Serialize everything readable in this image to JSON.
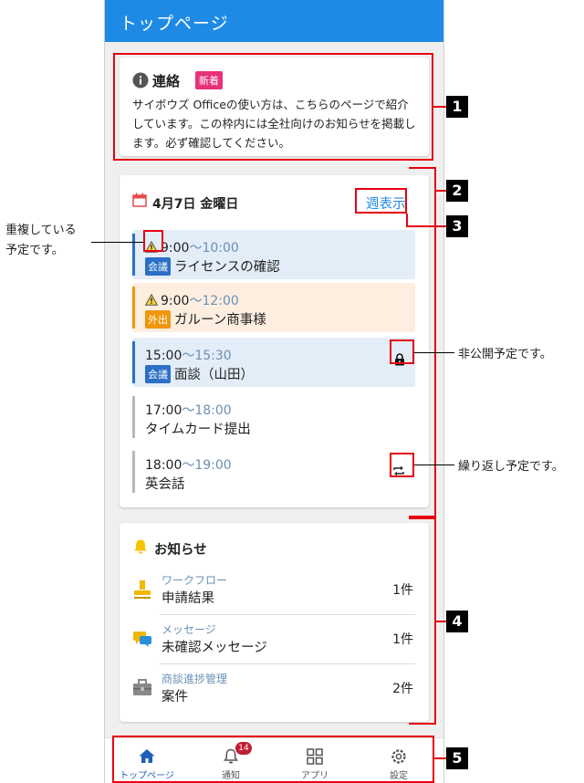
{
  "appbar": {
    "title": "トップページ"
  },
  "notice": {
    "icon": "info-icon",
    "title": "連絡",
    "badge": "新着",
    "body": "サイボウズ Officeの使い方は、こちらのページで紹介しています。この枠内には全社向けのお知らせを掲載します。必ず確認してください。"
  },
  "schedule": {
    "date": "4月7日 金曜日",
    "week_link": "週表示",
    "events": [
      {
        "start": "9:00",
        "end": "〜10:00",
        "tag": "会議",
        "title": "ライセンスの確認",
        "warning": true,
        "color": "#2b6fc6",
        "bg": "#e3edf8"
      },
      {
        "start": "9:00",
        "end": "〜12:00",
        "tag": "外出",
        "title": "ガルーン商事様",
        "warning": true,
        "color": "#f0960a",
        "bg": "#fdeee0"
      },
      {
        "start": "15:00",
        "end": "〜15:30",
        "tag": "会議",
        "title": "面談（山田）",
        "warning": false,
        "color": "#2b6fc6",
        "bg": "#e3edf8",
        "lock": true
      },
      {
        "start": "17:00",
        "end": "〜18:00",
        "tag": "",
        "title": "タイムカード提出",
        "warning": false,
        "color": "#b8b8b8",
        "bg": "#ffffff"
      },
      {
        "start": "18:00",
        "end": "〜19:00",
        "tag": "",
        "title": "英会話",
        "warning": false,
        "color": "#b8b8b8",
        "bg": "#ffffff",
        "repeat": true
      }
    ]
  },
  "notifications": {
    "title": "お知らせ",
    "items": [
      {
        "category": "ワークフロー",
        "name": "申請結果",
        "count": "1件",
        "icon": "stamp-icon"
      },
      {
        "category": "メッセージ",
        "name": "未確認メッセージ",
        "count": "1件",
        "icon": "message-icon"
      },
      {
        "category": "商談進捗管理",
        "name": "案件",
        "count": "2件",
        "icon": "briefcase-icon"
      }
    ]
  },
  "nav": {
    "home": "トップページ",
    "notify": "通知",
    "notify_badge": "14",
    "apps": "アプリ",
    "settings": "設定"
  },
  "annotations": {
    "n1": "1",
    "n2": "2",
    "n3": "3",
    "n4": "4",
    "n5": "5",
    "overlap": "重複している\n予定です。",
    "private": "非公開予定です。",
    "repeat": "繰り返し予定です。"
  },
  "colors": {
    "appbar": "#1f8ae6",
    "highlight": "#e60012",
    "badge": "#e8317a",
    "link": "#1f8ae6"
  }
}
